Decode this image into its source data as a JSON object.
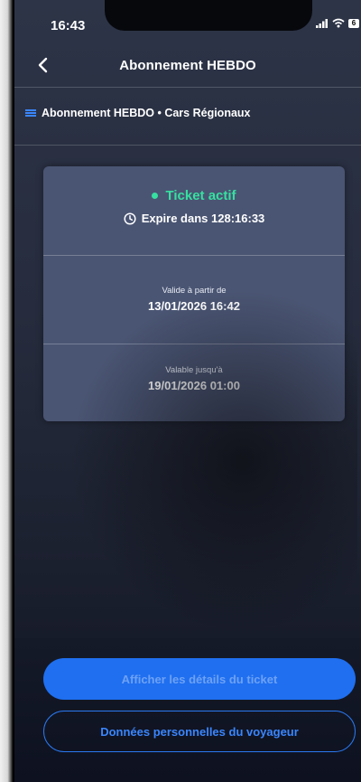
{
  "status_bar": {
    "time": "16:43",
    "battery": "6"
  },
  "header": {
    "title": "Abonnement HEBDO"
  },
  "subtitle": {
    "label": "Abonnement HEBDO • Cars Régionaux"
  },
  "ticket": {
    "status": "Ticket actif",
    "expire": "Expire dans 128:16:33",
    "valid_from_label": "Valide à partir de",
    "valid_from": "13/01/2026 16:42",
    "valid_until_label": "Valable jusqu'à",
    "valid_until": "19/01/2026 01:00",
    "status_color": "#36e0a0"
  },
  "actions": {
    "show_details": "Afficher les détails du ticket",
    "traveler_data": "Données personnelles du voyageur"
  },
  "colors": {
    "accent": "#1f6ff0",
    "card": "#4a5573"
  },
  "icons": {
    "back": "chevron-left-icon",
    "bus": "bus-icon",
    "clock": "clock-icon"
  }
}
